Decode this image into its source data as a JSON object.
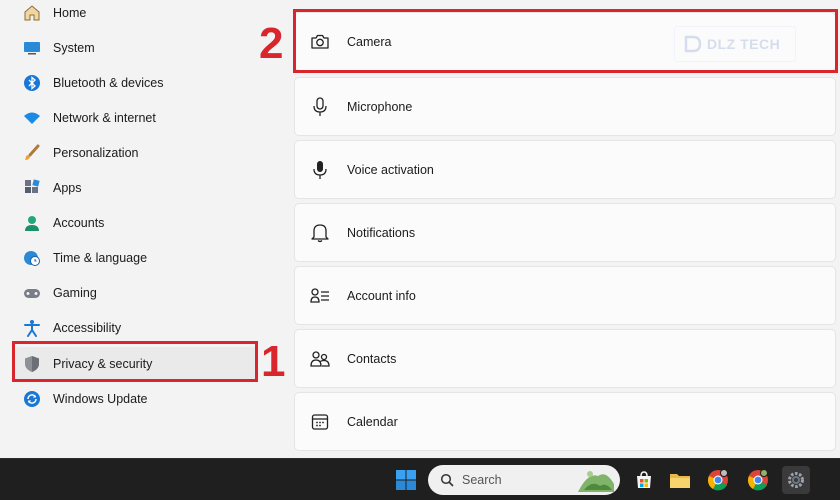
{
  "sidebar": {
    "items": [
      {
        "label": "Home",
        "icon": "home-icon"
      },
      {
        "label": "System",
        "icon": "system-icon"
      },
      {
        "label": "Bluetooth & devices",
        "icon": "bluetooth-icon"
      },
      {
        "label": "Network & internet",
        "icon": "wifi-icon"
      },
      {
        "label": "Personalization",
        "icon": "brush-icon"
      },
      {
        "label": "Apps",
        "icon": "apps-icon"
      },
      {
        "label": "Accounts",
        "icon": "person-icon"
      },
      {
        "label": "Time & language",
        "icon": "clock-globe-icon"
      },
      {
        "label": "Gaming",
        "icon": "gamepad-icon"
      },
      {
        "label": "Accessibility",
        "icon": "accessibility-icon"
      },
      {
        "label": "Privacy & security",
        "icon": "shield-icon",
        "selected": true
      },
      {
        "label": "Windows Update",
        "icon": "update-icon"
      }
    ]
  },
  "main": {
    "cards": [
      {
        "label": "Camera",
        "icon": "camera-icon"
      },
      {
        "label": "Microphone",
        "icon": "microphone-icon"
      },
      {
        "label": "Voice activation",
        "icon": "voice-icon"
      },
      {
        "label": "Notifications",
        "icon": "bell-icon"
      },
      {
        "label": "Account info",
        "icon": "account-info-icon"
      },
      {
        "label": "Contacts",
        "icon": "contacts-icon"
      },
      {
        "label": "Calendar",
        "icon": "calendar-icon"
      }
    ]
  },
  "annotations": {
    "step1": "1",
    "step2": "2"
  },
  "watermark": {
    "text": "DLZ TECH"
  },
  "taskbar": {
    "search_placeholder": "Search"
  },
  "colors": {
    "annotation": "#d9262c",
    "accent": "#0067c0",
    "taskbar": "#1f1f1f"
  }
}
